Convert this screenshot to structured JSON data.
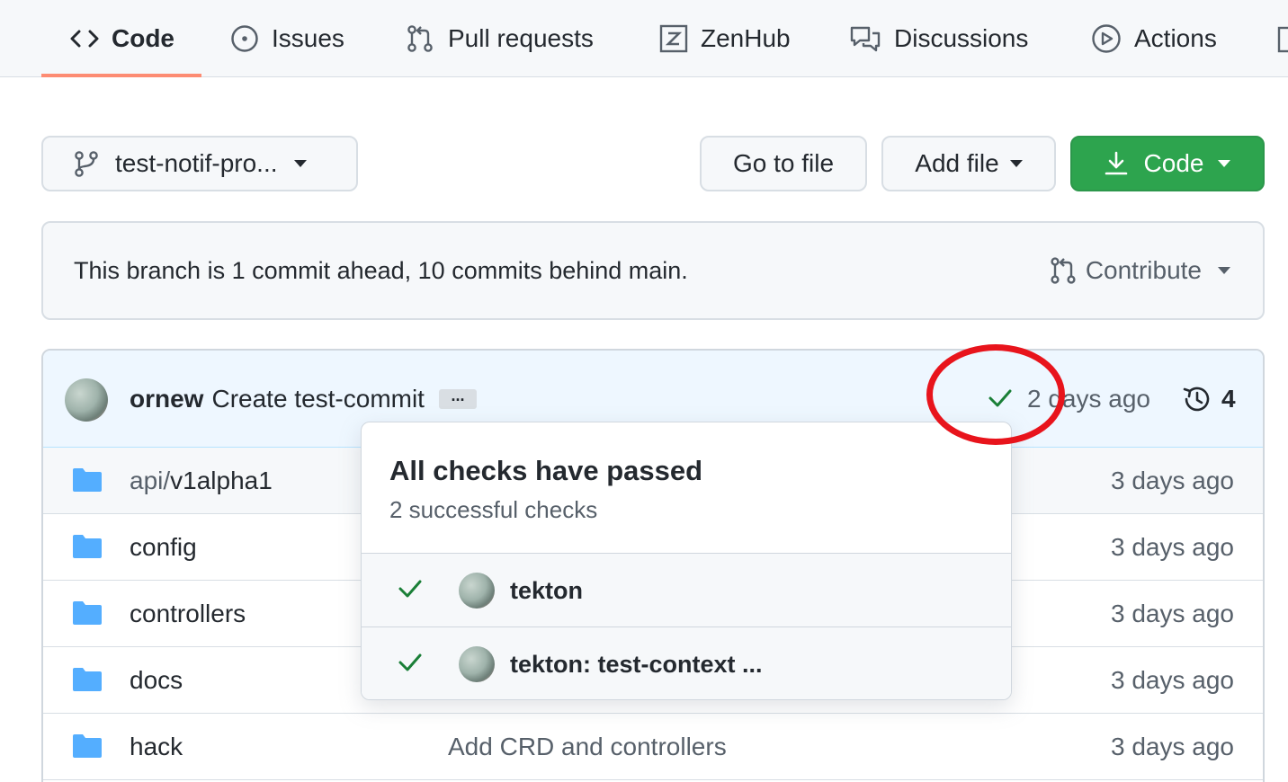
{
  "nav": {
    "tabs": [
      {
        "label": "Code",
        "icon": "code-icon",
        "active": true
      },
      {
        "label": "Issues",
        "icon": "issue-opened-icon"
      },
      {
        "label": "Pull requests",
        "icon": "git-pull-request-icon"
      },
      {
        "label": "ZenHub",
        "icon": "zenhub-icon"
      },
      {
        "label": "Discussions",
        "icon": "comment-discussion-icon"
      },
      {
        "label": "Actions",
        "icon": "play-icon"
      }
    ],
    "underline_color": "#fd8c73"
  },
  "toolbar": {
    "branch_label": "test-notif-pro...",
    "goto_label": "Go to file",
    "addfile_label": "Add file",
    "code_label": "Code",
    "code_color": "#2da44e"
  },
  "branch_info": {
    "message": "This branch is 1 commit ahead, 10 commits behind main.",
    "contribute_label": "Contribute"
  },
  "latest_commit": {
    "author": "ornew",
    "message": "Create test-commit",
    "ellipsis": "...",
    "time": "2 days ago",
    "history_count": "4",
    "status_color": "#1a7f37"
  },
  "files": [
    {
      "dir_prefix": "api/",
      "name": "v1alpha1",
      "message": "",
      "time": "3 days ago"
    },
    {
      "dir_prefix": "",
      "name": "config",
      "message": "",
      "time": "3 days ago"
    },
    {
      "dir_prefix": "",
      "name": "controllers",
      "message": "",
      "time": "3 days ago"
    },
    {
      "dir_prefix": "",
      "name": "docs",
      "message": "",
      "time": "3 days ago"
    },
    {
      "dir_prefix": "",
      "name": "hack",
      "message": "Add CRD and controllers",
      "time": "3 days ago"
    }
  ],
  "checks_popover": {
    "title": "All checks have passed",
    "subtitle": "2 successful checks",
    "items": [
      {
        "name": "tekton"
      },
      {
        "name": "tekton: test-context ..."
      }
    ]
  },
  "annotation": {
    "color": "#e8141c"
  }
}
